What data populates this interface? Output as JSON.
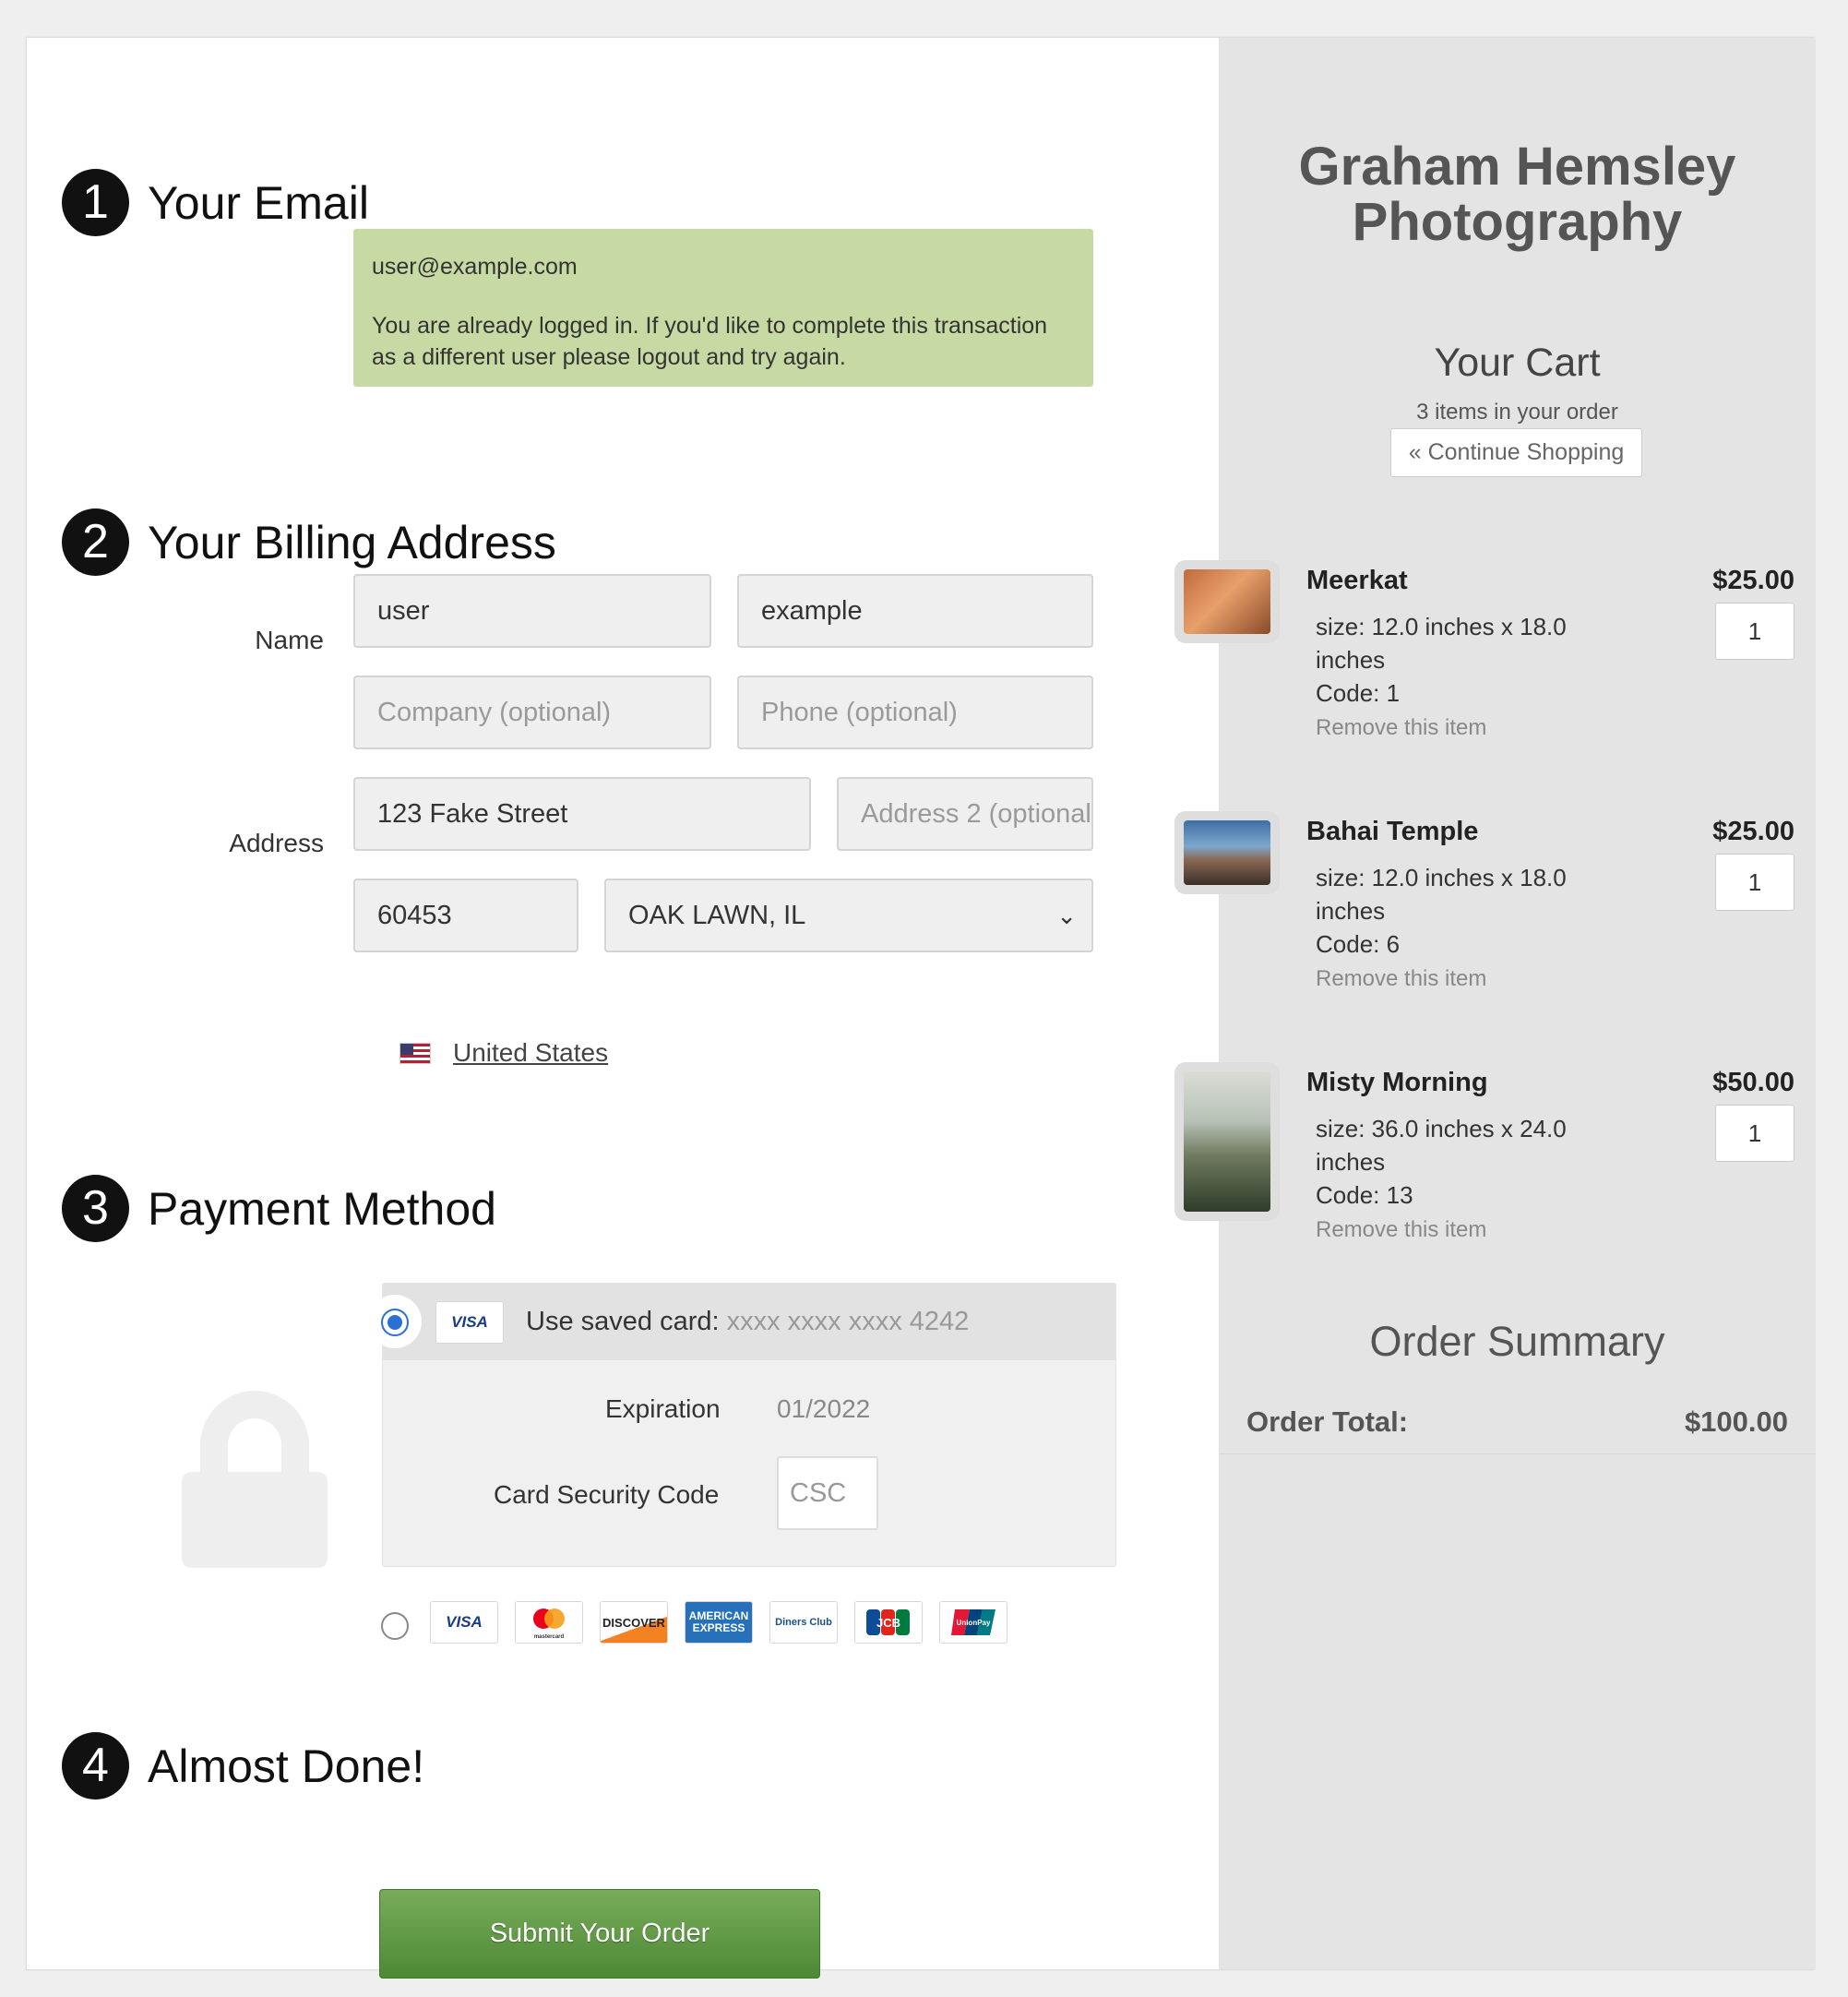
{
  "steps": [
    {
      "num": "1",
      "title": "Your Email"
    },
    {
      "num": "2",
      "title": "Your Billing Address"
    },
    {
      "num": "3",
      "title": "Payment Method"
    },
    {
      "num": "4",
      "title": "Almost Done!"
    }
  ],
  "email": {
    "address": "user@example.com",
    "message": "You are already logged in. If you'd like to complete this transaction as a different user please logout and try again."
  },
  "billing": {
    "name_label": "Name",
    "address_label": "Address",
    "first_name": "user",
    "last_name": "example",
    "company_placeholder": "Company (optional)",
    "phone_placeholder": "Phone (optional)",
    "address1": "123 Fake Street",
    "address2_placeholder": "Address 2 (optional)",
    "zip": "60453",
    "city_state": "OAK LAWN, IL",
    "country": "United States"
  },
  "payment": {
    "saved_label": "Use saved card:",
    "saved_number": "xxxx xxxx xxxx 4242",
    "saved_brand": "VISA",
    "expiration_label": "Expiration",
    "expiration_value": "01/2022",
    "csc_label": "Card Security Code",
    "csc_placeholder": "CSC",
    "card_brands": [
      "VISA",
      "mastercard",
      "DISCOVER",
      "AMERICAN EXPRESS",
      "Diners Club",
      "JCB",
      "UnionPay"
    ]
  },
  "submit_label": "Submit Your Order",
  "store": {
    "name": "Graham Hemsley Photography"
  },
  "cart": {
    "title": "Your Cart",
    "count": "3 items in your order",
    "continue_label": "« Continue Shopping",
    "items": [
      {
        "name": "Meerkat",
        "price": "$25.00",
        "size": "size: 12.0 inches x 18.0 inches",
        "code": "Code: 1",
        "qty": "1",
        "remove": "Remove this item"
      },
      {
        "name": "Bahai Temple",
        "price": "$25.00",
        "size": "size: 12.0 inches x 18.0 inches",
        "code": "Code: 6",
        "qty": "1",
        "remove": "Remove this item"
      },
      {
        "name": "Misty Morning",
        "price": "$50.00",
        "size": "size: 36.0 inches x 24.0 inches",
        "code": "Code: 13",
        "qty": "1",
        "remove": "Remove this item"
      }
    ]
  },
  "summary": {
    "title": "Order Summary",
    "total_label": "Order Total:",
    "total_value": "$100.00"
  }
}
